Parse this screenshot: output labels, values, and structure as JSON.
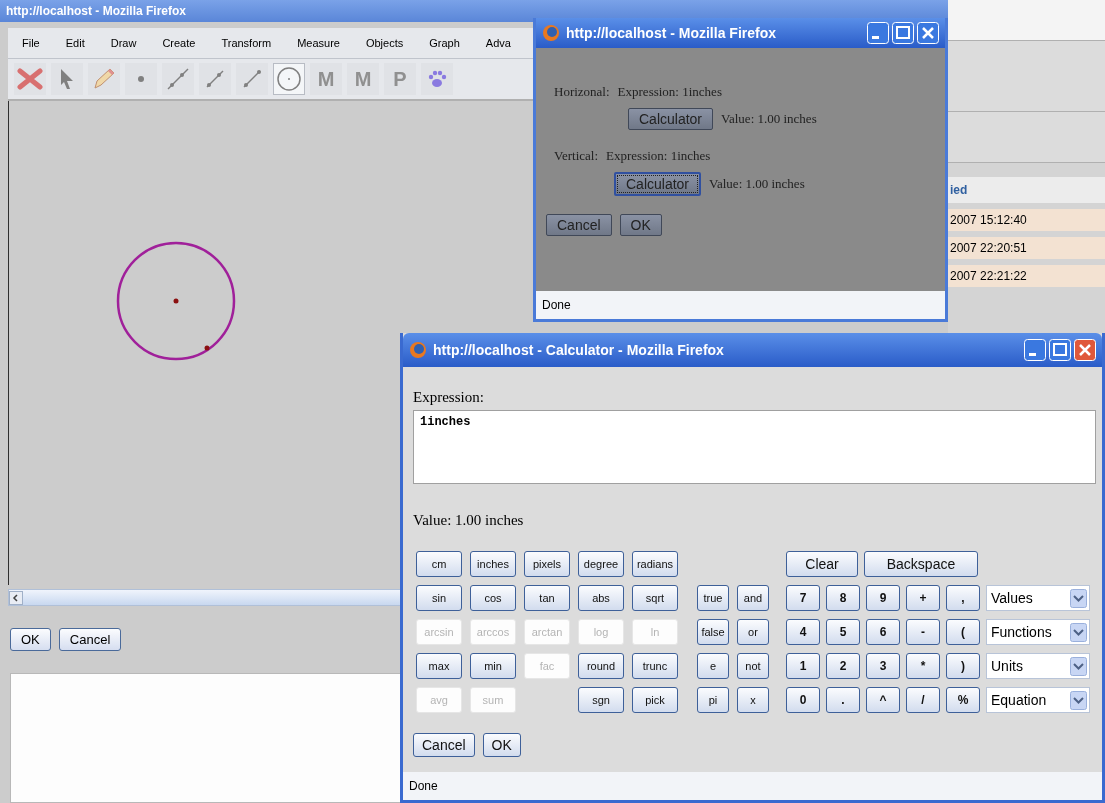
{
  "main_window": {
    "title": "http://localhost - Mozilla Firefox",
    "menu": [
      "File",
      "Edit",
      "Draw",
      "Create",
      "Transform",
      "Measure",
      "Objects",
      "Graph",
      "Adva"
    ],
    "tools": [
      {
        "kind": "delete",
        "selected": false
      },
      {
        "kind": "pointer",
        "selected": false
      },
      {
        "kind": "pencil",
        "selected": false
      },
      {
        "kind": "point",
        "selected": false
      },
      {
        "kind": "line",
        "selected": false
      },
      {
        "kind": "segment",
        "selected": false
      },
      {
        "kind": "ray",
        "selected": false
      },
      {
        "kind": "circle",
        "selected": true
      },
      {
        "kind": "text",
        "label": "M",
        "selected": false
      },
      {
        "kind": "text",
        "label": "M",
        "selected": false
      },
      {
        "kind": "text",
        "label": "P",
        "selected": false
      },
      {
        "kind": "paw",
        "selected": false
      }
    ],
    "buttons": [
      "OK",
      "Cancel"
    ]
  },
  "background_table": {
    "header": "ied",
    "rows": [
      "2007 15:12:40",
      "2007 22:20:51",
      "2007 22:21:22"
    ]
  },
  "dimension_dialog": {
    "title": "http://localhost - Mozilla Firefox",
    "rows": [
      {
        "label": "Horizonal:",
        "expression": "Expression:  1inches",
        "button": "Calculator",
        "focused": false,
        "value": "Value:  1.00 inches"
      },
      {
        "label": "Vertical:",
        "expression": "Expression:  1inches",
        "button": "Calculator",
        "focused": true,
        "value": "Value:  1.00 inches"
      }
    ],
    "buttons": [
      "Cancel",
      "OK"
    ],
    "status": "Done"
  },
  "calculator": {
    "title": "http://localhost - Calculator - Mozilla Firefox",
    "expression_label": "Expression:",
    "expression": "1inches",
    "value": "Value:  1.00 inches",
    "rows": [
      {
        "left": [
          {
            "kind": "key",
            "label": "cm",
            "disabled": false
          },
          {
            "kind": "key",
            "label": "inches",
            "disabled": false
          },
          {
            "kind": "key",
            "label": "pixels",
            "disabled": false
          },
          {
            "kind": "key",
            "label": "degree",
            "disabled": false
          },
          {
            "kind": "key",
            "label": "radians",
            "disabled": false
          }
        ],
        "right": [
          {
            "kind": "wide",
            "label": "Clear",
            "disabled": false
          },
          {
            "kind": "wide",
            "label": "Backspace",
            "disabled": false
          }
        ]
      },
      {
        "left": [
          {
            "kind": "key",
            "label": "sin",
            "disabled": false
          },
          {
            "kind": "key",
            "label": "cos",
            "disabled": false
          },
          {
            "kind": "key",
            "label": "tan",
            "disabled": false
          },
          {
            "kind": "key",
            "label": "abs",
            "disabled": false
          },
          {
            "kind": "key",
            "label": "sqrt",
            "disabled": false
          }
        ],
        "mid": [
          {
            "kind": "key",
            "label": "true",
            "disabled": false
          },
          {
            "kind": "key",
            "label": "and",
            "disabled": false
          }
        ],
        "right": [
          {
            "kind": "key",
            "label": "7",
            "disabled": false
          },
          {
            "kind": "key",
            "label": "8",
            "disabled": false
          },
          {
            "kind": "key",
            "label": "9",
            "disabled": false
          },
          {
            "kind": "key",
            "label": "+",
            "disabled": false
          },
          {
            "kind": "key",
            "label": ",",
            "disabled": false
          }
        ],
        "select": "Values"
      },
      {
        "left": [
          {
            "kind": "key",
            "label": "arcsin",
            "disabled": true
          },
          {
            "kind": "key",
            "label": "arccos",
            "disabled": true
          },
          {
            "kind": "key",
            "label": "arctan",
            "disabled": true
          },
          {
            "kind": "key",
            "label": "log",
            "disabled": true
          },
          {
            "kind": "key",
            "label": "ln",
            "disabled": true
          }
        ],
        "mid": [
          {
            "kind": "key",
            "label": "false",
            "disabled": false
          },
          {
            "kind": "key",
            "label": "or",
            "disabled": false
          }
        ],
        "right": [
          {
            "kind": "key",
            "label": "4",
            "disabled": false
          },
          {
            "kind": "key",
            "label": "5",
            "disabled": false
          },
          {
            "kind": "key",
            "label": "6",
            "disabled": false
          },
          {
            "kind": "key",
            "label": "-",
            "disabled": false
          },
          {
            "kind": "key",
            "label": "(",
            "disabled": false
          }
        ],
        "select": "Functions"
      },
      {
        "left": [
          {
            "kind": "key",
            "label": "max",
            "disabled": false
          },
          {
            "kind": "key",
            "label": "min",
            "disabled": false
          },
          {
            "kind": "key",
            "label": "fac",
            "disabled": true
          },
          {
            "kind": "key",
            "label": "round",
            "disabled": false
          },
          {
            "kind": "key",
            "label": "trunc",
            "disabled": false
          }
        ],
        "mid": [
          {
            "kind": "key",
            "label": "e",
            "disabled": false
          },
          {
            "kind": "key",
            "label": "not",
            "disabled": false
          }
        ],
        "right": [
          {
            "kind": "key",
            "label": "1",
            "disabled": false
          },
          {
            "kind": "key",
            "label": "2",
            "disabled": false
          },
          {
            "kind": "key",
            "label": "3",
            "disabled": false
          },
          {
            "kind": "key",
            "label": "*",
            "disabled": false
          },
          {
            "kind": "key",
            "label": ")",
            "disabled": false
          }
        ],
        "select": "Units"
      },
      {
        "left": [
          {
            "kind": "key",
            "label": "avg",
            "disabled": true
          },
          {
            "kind": "key",
            "label": "sum",
            "disabled": true
          },
          {
            "kind": "gap"
          },
          {
            "kind": "key",
            "label": "sgn",
            "disabled": false
          },
          {
            "kind": "key",
            "label": "pick",
            "disabled": false
          }
        ],
        "mid": [
          {
            "kind": "key",
            "label": "pi",
            "disabled": false
          },
          {
            "kind": "key",
            "label": "x",
            "disabled": false
          }
        ],
        "right": [
          {
            "kind": "key",
            "label": "0",
            "disabled": false
          },
          {
            "kind": "key",
            "label": ".",
            "disabled": false
          },
          {
            "kind": "key",
            "label": "^",
            "disabled": false
          },
          {
            "kind": "key",
            "label": "/",
            "disabled": false
          },
          {
            "kind": "key",
            "label": "%",
            "disabled": false
          }
        ],
        "select": "Equation"
      }
    ],
    "buttons": [
      "Cancel",
      "OK"
    ],
    "status": "Done"
  }
}
